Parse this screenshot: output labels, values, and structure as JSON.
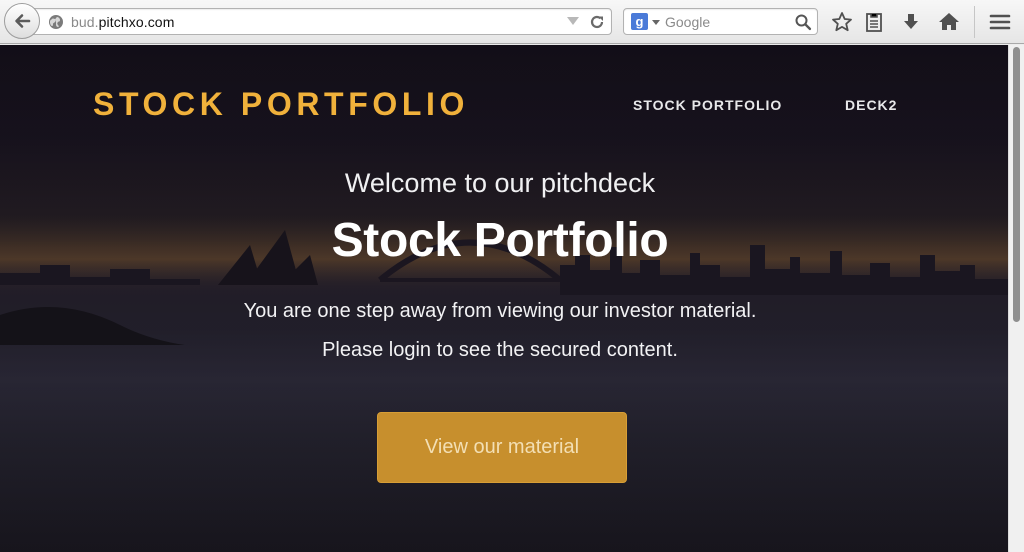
{
  "browser": {
    "url_scheme_hidden": "bud.",
    "url_host": "pitchxo.com",
    "search_placeholder": "Google"
  },
  "icons": [
    "back-arrow-icon",
    "globe-icon",
    "dropdown-arrow-icon",
    "reload-icon",
    "google-logo-icon",
    "search-icon",
    "bookmark-star-icon",
    "reading-list-icon",
    "download-icon",
    "home-icon",
    "menu-icon"
  ],
  "site": {
    "brand": "STOCK PORTFOLIO",
    "nav": [
      {
        "label": "STOCK PORTFOLIO"
      },
      {
        "label": "DECK2"
      }
    ]
  },
  "hero": {
    "welcome": "Welcome to our pitchdeck",
    "title": "Stock Portfolio",
    "line1": "You are one step away from viewing our investor material.",
    "line2": "Please login to see the secured content.",
    "cta_label": "View our material"
  },
  "colors": {
    "brand": "#f0b13b",
    "cta_bg": "#c78f2d",
    "cta_text": "#f3dfb4"
  }
}
